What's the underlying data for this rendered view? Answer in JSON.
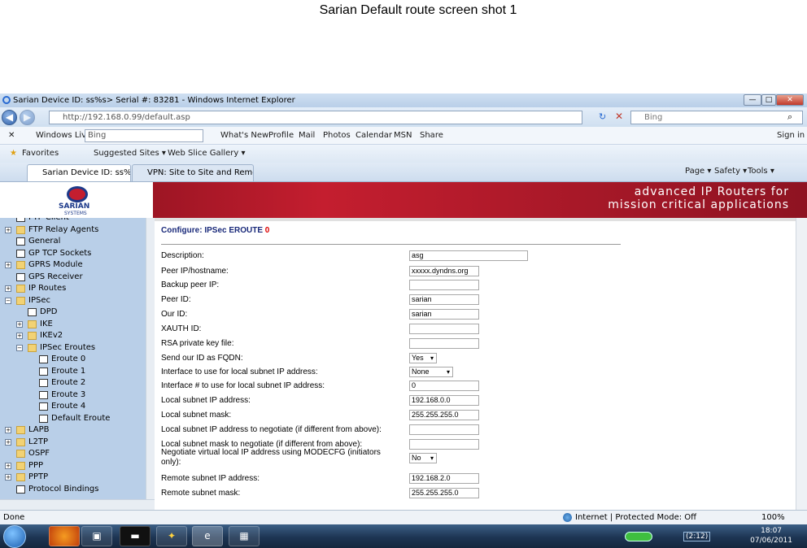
{
  "doc_title": "Sarian Default route screen shot 1",
  "window": {
    "title": "Sarian Device ID: ss%s> Serial #: 83281 - Windows Internet Explorer",
    "min": "—",
    "max": "□",
    "close": "✕"
  },
  "address": {
    "url": "http://192.168.0.99/default.asp",
    "search_placeholder": "Bing"
  },
  "windows_live": {
    "label": "Windows Live",
    "search_value": "Bing",
    "links": [
      "What's New",
      "Profile",
      "Mail",
      "Photos",
      "Calendar",
      "MSN",
      "Share"
    ],
    "signin": "Sign in"
  },
  "favorites": {
    "label": "Favorites",
    "items": [
      "Suggested Sites ▾",
      "Web Slice Gallery ▾"
    ]
  },
  "tabs": [
    {
      "label": "Sarian Device ID: ss%s>..."
    },
    {
      "label": "VPN: Site to Site and Remo..."
    }
  ],
  "cmdbar": [
    "Page ▾",
    "Safety ▾",
    "Tools ▾"
  ],
  "banner": {
    "logo": "SARIAN",
    "logo_sub": "SYSTEMS",
    "tagline_1": "advanced IP Routers for",
    "tagline_2": "mission critical applications"
  },
  "tree": [
    {
      "label": "FTP Client",
      "type": "page",
      "level": 1,
      "pm": ""
    },
    {
      "label": "FTP Relay Agents",
      "type": "folder",
      "level": 1,
      "pm": "+"
    },
    {
      "label": "General",
      "type": "page",
      "level": 1,
      "pm": ""
    },
    {
      "label": "GP TCP Sockets",
      "type": "page",
      "level": 1,
      "pm": ""
    },
    {
      "label": "GPRS Module",
      "type": "folder",
      "level": 1,
      "pm": "+"
    },
    {
      "label": "GPS Receiver",
      "type": "page",
      "level": 1,
      "pm": ""
    },
    {
      "label": "IP Routes",
      "type": "folder",
      "level": 1,
      "pm": "+"
    },
    {
      "label": "IPSec",
      "type": "folder",
      "level": 1,
      "pm": "−"
    },
    {
      "label": "DPD",
      "type": "page",
      "level": 2,
      "pm": ""
    },
    {
      "label": "IKE",
      "type": "folder",
      "level": 2,
      "pm": "+"
    },
    {
      "label": "IKEv2",
      "type": "folder",
      "level": 2,
      "pm": "+"
    },
    {
      "label": "IPSec Eroutes",
      "type": "folder",
      "level": 2,
      "pm": "−"
    },
    {
      "label": "Eroute 0",
      "type": "page",
      "level": 3,
      "pm": ""
    },
    {
      "label": "Eroute 1",
      "type": "page",
      "level": 3,
      "pm": ""
    },
    {
      "label": "Eroute 2",
      "type": "page",
      "level": 3,
      "pm": ""
    },
    {
      "label": "Eroute 3",
      "type": "page",
      "level": 3,
      "pm": ""
    },
    {
      "label": "Eroute 4",
      "type": "page",
      "level": 3,
      "pm": ""
    },
    {
      "label": "Default Eroute",
      "type": "page",
      "level": 3,
      "pm": ""
    },
    {
      "label": "LAPB",
      "type": "folder",
      "level": 1,
      "pm": "+"
    },
    {
      "label": "L2TP",
      "type": "folder",
      "level": 1,
      "pm": "+"
    },
    {
      "label": "OSPF",
      "type": "folder",
      "level": 1,
      "pm": ""
    },
    {
      "label": "PPP",
      "type": "folder",
      "level": 1,
      "pm": "+"
    },
    {
      "label": "PPTP",
      "type": "folder",
      "level": 1,
      "pm": "+"
    },
    {
      "label": "Protocol Bindings",
      "type": "page",
      "level": 1,
      "pm": ""
    }
  ],
  "form": {
    "title": "Configure: IPSec EROUTE",
    "title_num": "0",
    "fields": [
      {
        "label": "Description:",
        "value": "asg",
        "kind": "text",
        "w": "wide"
      },
      {
        "label": "Peer IP/hostname:",
        "value": "xxxxx.dyndns.org",
        "kind": "text",
        "w": "mid"
      },
      {
        "label": "Backup peer IP:",
        "value": "",
        "kind": "text",
        "w": "mid"
      },
      {
        "label": "Peer ID:",
        "value": "sarian",
        "kind": "text",
        "w": "mid"
      },
      {
        "label": "Our ID:",
        "value": "sarian",
        "kind": "text",
        "w": "mid"
      },
      {
        "label": "XAUTH ID:",
        "value": "",
        "kind": "text",
        "w": "mid"
      },
      {
        "label": "RSA private key file:",
        "value": "",
        "kind": "text",
        "w": "mid"
      },
      {
        "label": "Send our ID as FQDN:",
        "value": "Yes",
        "kind": "select",
        "w": "s1"
      },
      {
        "label": "Interface to use for local subnet IP address:",
        "value": "None",
        "kind": "select",
        "w": "s2"
      },
      {
        "label": "Interface # to use for local subnet IP address:",
        "value": "0",
        "kind": "text",
        "w": "mid"
      },
      {
        "label": "Local subnet IP address:",
        "value": "192.168.0.0",
        "kind": "text",
        "w": "mid"
      },
      {
        "label": "Local subnet mask:",
        "value": "255.255.255.0",
        "kind": "text",
        "w": "mid"
      },
      {
        "label": "Local subnet IP address to negotiate (if different from above):",
        "value": "",
        "kind": "text",
        "w": "mid"
      },
      {
        "label": "Local subnet mask to negotiate (if different from above):",
        "value": "",
        "kind": "text",
        "w": "mid"
      },
      {
        "label": "Negotiate virtual local IP address using MODECFG (initiators only):",
        "value": "No",
        "kind": "select",
        "w": "s1"
      },
      {
        "label": "Remote subnet IP address:",
        "value": "192.168.2.0",
        "kind": "text",
        "w": "mid"
      },
      {
        "label": "Remote subnet mask:",
        "value": "255.255.255.0",
        "kind": "text",
        "w": "mid"
      }
    ]
  },
  "status": {
    "left": "Done",
    "zone": "Internet | Protected Mode: Off",
    "zoom": "100%"
  },
  "taskbar": {
    "time": "18:07",
    "date": "07/06/2011",
    "battery": "(2:12)"
  }
}
